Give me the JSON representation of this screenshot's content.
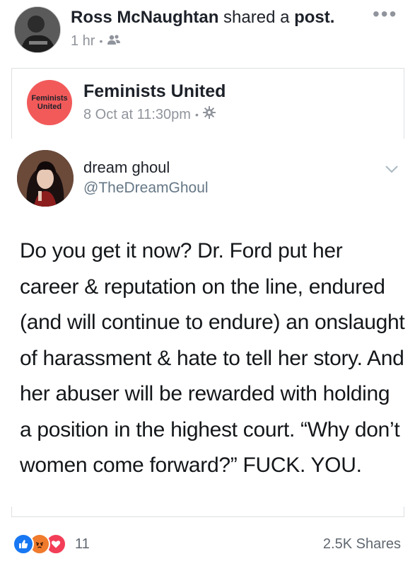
{
  "post": {
    "author": "Ross McNaughtan",
    "action": "shared a",
    "object": "post.",
    "time": "1 hr",
    "privacy_icon": "friends-icon",
    "more_icon": "more-options-icon"
  },
  "shared_page": {
    "name": "Feminists United",
    "avatar_text_line1": "Feminists",
    "avatar_text_line2": "United",
    "timestamp": "8 Oct at 11:30pm",
    "privacy_icon": "settings-icon",
    "avatar_color": "#f25a5a"
  },
  "tweet": {
    "display_name": "dream ghoul",
    "handle": "@TheDreamGhoul",
    "text": "Do you get it now? Dr. Ford put her career & reputation on the line, endured (and will continue to endure) an onslaught of harassment & hate to tell her story. And her abuser will be rewarded with holding a position in the highest court. “Why don’t women come forward?” FUCK. YOU."
  },
  "footer": {
    "reaction_count": "11",
    "shares": "2.5K Shares",
    "reactions": [
      "like-icon",
      "angry-icon",
      "love-icon"
    ]
  },
  "colors": {
    "like": "#1877f2",
    "angry": "#f07b2c",
    "love": "#f33e58",
    "meta_gray": "#90949c"
  }
}
